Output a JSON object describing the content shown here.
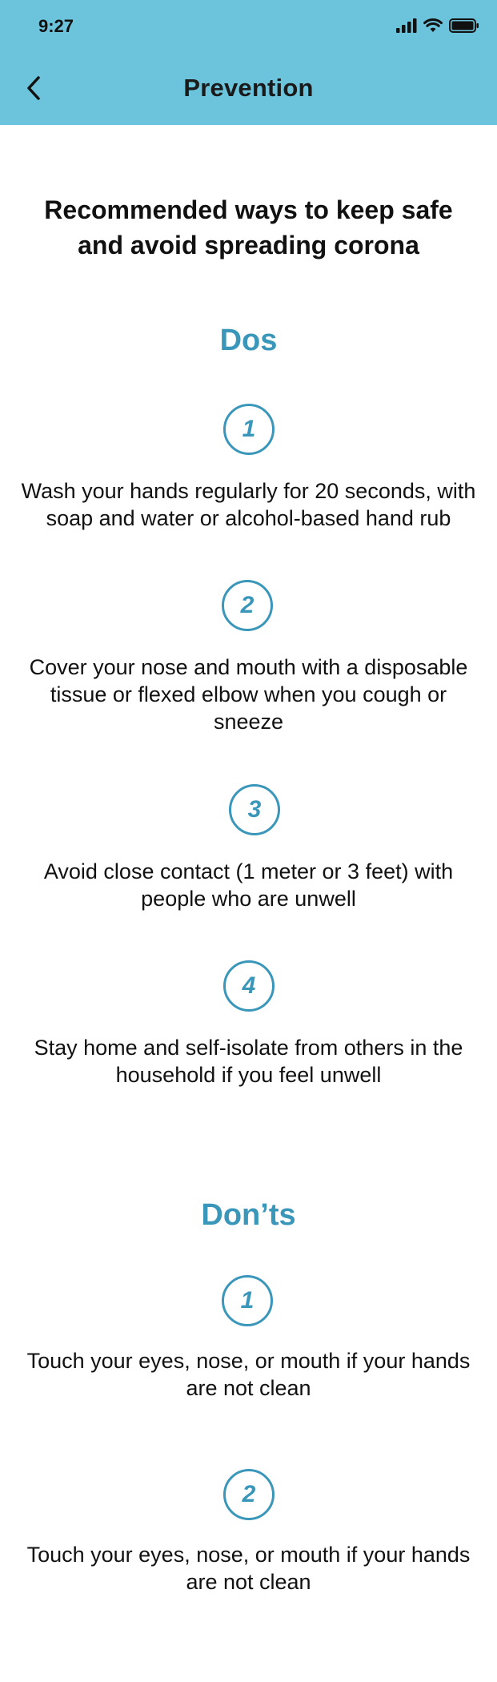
{
  "status_bar": {
    "time": "9:27"
  },
  "nav": {
    "title": "Prevention"
  },
  "intro": {
    "text": "Recommended ways to keep safe and avoid spreading corona"
  },
  "dos": {
    "title": "Dos",
    "items": [
      {
        "number": "1",
        "text": "Wash your hands regularly for 20 seconds, with soap and water or alcohol-based hand rub"
      },
      {
        "number": "2",
        "text": "Cover your nose and mouth with a disposable tissue or flexed elbow when you cough or sneeze"
      },
      {
        "number": "3",
        "text": "Avoid close contact (1 meter or 3 feet) with people who are unwell"
      },
      {
        "number": "4",
        "text": "Stay home and self-isolate from others in the household if you feel unwell"
      }
    ]
  },
  "donts": {
    "title": "Don’ts",
    "items": [
      {
        "number": "1",
        "text": "Touch your eyes, nose, or mouth if your hands are not clean"
      },
      {
        "number": "2",
        "text": "Touch your eyes, nose, or mouth if your hands are not clean"
      }
    ]
  },
  "icons": {
    "back": "chevron-left-icon",
    "signal": "cellular-signal-icon",
    "wifi": "wifi-icon",
    "battery": "battery-icon"
  },
  "colors": {
    "header_bg": "#6cc3dc",
    "accent": "#3a97ba",
    "text": "#111111",
    "background": "#ffffff"
  }
}
